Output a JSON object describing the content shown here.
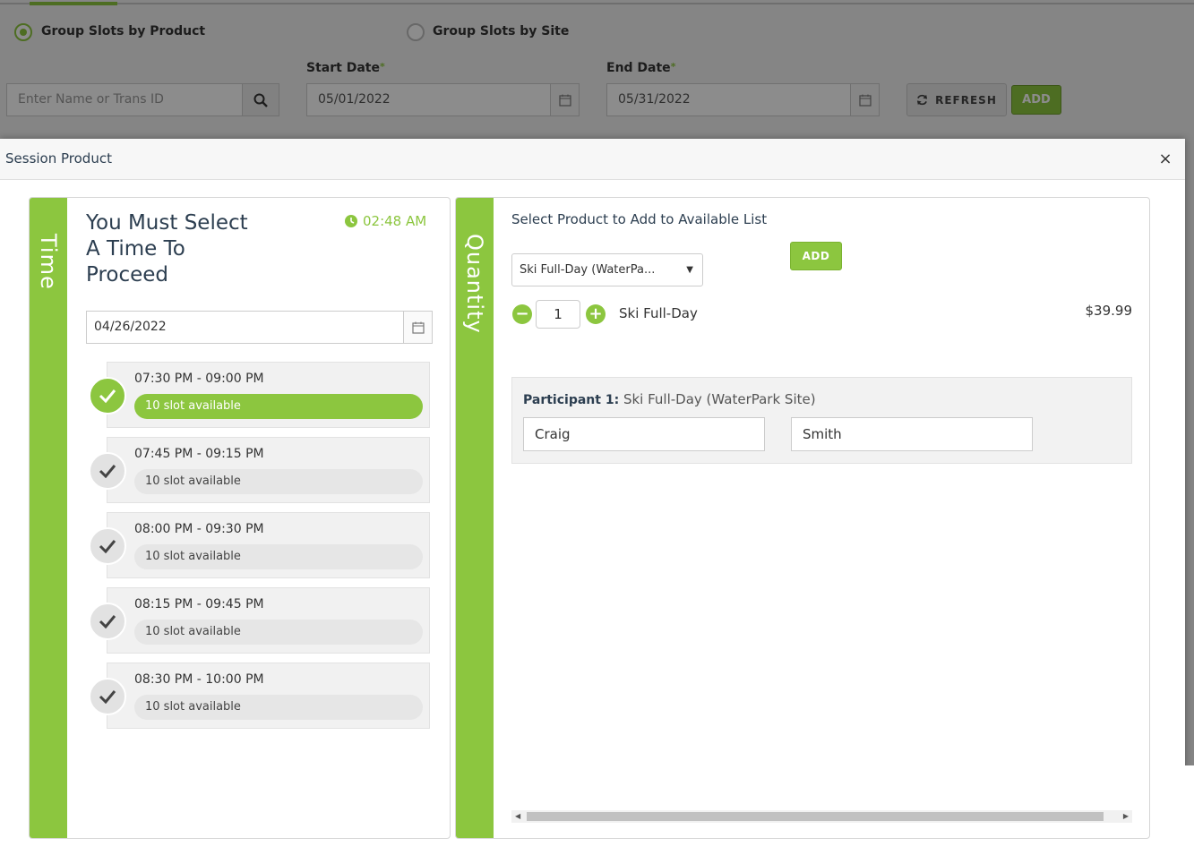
{
  "background": {
    "radio_by_product": "Group Slots by Product",
    "radio_by_site": "Group Slots by Site",
    "start_date_label": "Start Date",
    "end_date_label": "End Date",
    "required_marker": "*",
    "search_placeholder": "Enter Name or Trans ID",
    "start_date": "05/01/2022",
    "end_date": "05/31/2022",
    "refresh_label": "REFRESH",
    "add_label": "ADD"
  },
  "modal": {
    "title": "Session Product",
    "close": "×"
  },
  "time_panel": {
    "bar_label": "Time",
    "prompt": "You Must Select A Time To Proceed",
    "clock": "02:48 AM",
    "date": "04/26/2022",
    "slots": [
      {
        "time": "07:30 PM - 09:00 PM",
        "availability": "10 slot available",
        "selected": true
      },
      {
        "time": "07:45 PM - 09:15 PM",
        "availability": "10 slot available",
        "selected": false
      },
      {
        "time": "08:00 PM - 09:30 PM",
        "availability": "10 slot available",
        "selected": false
      },
      {
        "time": "08:15 PM - 09:45 PM",
        "availability": "10 slot available",
        "selected": false
      },
      {
        "time": "08:30 PM - 10:00 PM",
        "availability": "10 slot available",
        "selected": false
      }
    ]
  },
  "quantity_panel": {
    "bar_label": "Quantity",
    "select_prompt": "Select Product to Add to Available List",
    "selected_product": "Ski Full-Day (WaterPa...",
    "add_label": "ADD",
    "line_item": {
      "quantity": "1",
      "name": "Ski Full-Day",
      "price": "$39.99"
    },
    "participant": {
      "label": "Participant 1:",
      "product": "Ski Full-Day (WaterPark Site)",
      "first_name": "Craig",
      "last_name": "Smith"
    }
  },
  "colors": {
    "accent": "#8cc63f",
    "heading": "#2c3e50"
  }
}
